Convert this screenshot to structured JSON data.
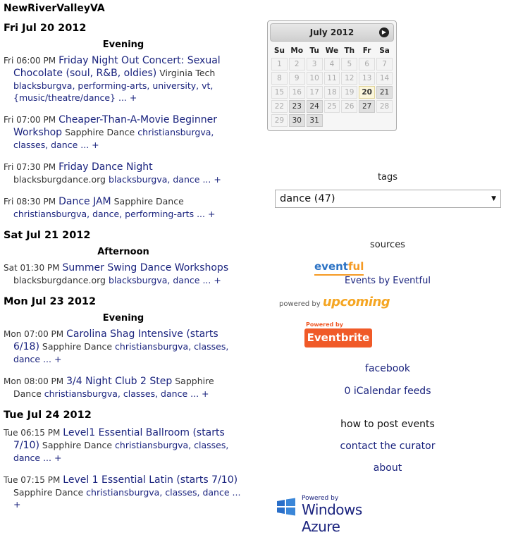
{
  "site": {
    "title": "NewRiverValleyVA"
  },
  "days": [
    {
      "header": "Fri Jul 20 2012",
      "period": "Evening",
      "events": [
        {
          "time": "Fri 06:00 PM",
          "title": "Friday Night Out Concert: Sexual Chocolate (soul, R&B, oldies)",
          "venue": "Virginia Tech",
          "tags": "blacksburgva, performing-arts, university, vt, {music/theatre/dance}",
          "more": "... +"
        },
        {
          "time": "Fri 07:00 PM",
          "title": "Cheaper-Than-A-Movie Beginner Workshop",
          "venue": "Sapphire Dance",
          "tags": "christiansburgva, classes, dance",
          "more": "... +"
        },
        {
          "time": "Fri 07:30 PM",
          "title": "Friday Dance Night",
          "venue": "blacksburgdance.org",
          "tags": "blacksburgva, dance",
          "more": "... +"
        },
        {
          "time": "Fri 08:30 PM",
          "title": "Dance JAM",
          "venue": "Sapphire Dance",
          "tags": "christiansburgva, dance, performing-arts",
          "more": "... +"
        }
      ]
    },
    {
      "header": "Sat Jul 21 2012",
      "period": "Afternoon",
      "events": [
        {
          "time": "Sat 01:30 PM",
          "title": "Summer Swing Dance Workshops",
          "venue": "blacksburgdance.org",
          "tags": "blacksburgva, dance",
          "more": "... +"
        }
      ]
    },
    {
      "header": "Mon Jul 23 2012",
      "period": "Evening",
      "events": [
        {
          "time": "Mon 07:00 PM",
          "title": "Carolina Shag Intensive (starts 6/18)",
          "venue": "Sapphire Dance",
          "tags": "christiansburgva, classes, dance",
          "more": "... +"
        },
        {
          "time": "Mon 08:00 PM",
          "title": "3/4 Night Club 2 Step",
          "venue": "Sapphire Dance",
          "tags": "christiansburgva, classes, dance",
          "more": "... +"
        }
      ]
    },
    {
      "header": "Tue Jul 24 2012",
      "period": "",
      "events": [
        {
          "time": "Tue 06:15 PM",
          "title": "Level1 Essential Ballroom (starts 7/10)",
          "venue": "Sapphire Dance",
          "tags": "christiansburgva, classes, dance",
          "more": "... +"
        },
        {
          "time": "Tue 07:15 PM",
          "title": "Level 1 Essential Latin (starts 7/10)",
          "venue": "Sapphire Dance",
          "tags": "christiansburgva, classes, dance",
          "more": "... +"
        }
      ]
    }
  ],
  "calendar": {
    "month_label": "July 2012",
    "next_icon": "next-arrow-icon",
    "weekdays": [
      "Su",
      "Mo",
      "Tu",
      "We",
      "Th",
      "Fr",
      "Sa"
    ],
    "weeks": [
      [
        "1",
        "2",
        "3",
        "4",
        "5",
        "6",
        "7"
      ],
      [
        "8",
        "9",
        "10",
        "11",
        "12",
        "13",
        "14"
      ],
      [
        "15",
        "16",
        "17",
        "18",
        "19",
        "20",
        "21"
      ],
      [
        "22",
        "23",
        "24",
        "25",
        "26",
        "27",
        "28"
      ],
      [
        "29",
        "30",
        "31",
        "",
        "",
        "",
        ""
      ]
    ],
    "highlighted": [
      "20",
      "21",
      "23",
      "24",
      "27",
      "30",
      "31"
    ],
    "today": "20"
  },
  "sidebar": {
    "tags_label": "tags",
    "tags_selected": "dance (47)",
    "sources_label": "sources",
    "eventful_logo_a": "event",
    "eventful_logo_b": "ful",
    "eventful_link": "Events by Eventful",
    "upcoming_small": "powered by",
    "upcoming_big": "upcoming",
    "eventbrite_small": "Powered by",
    "eventbrite_big": "Eventbrite",
    "facebook": "facebook",
    "ical": "0 iCalendar feeds",
    "howto": "how to post events",
    "contact": "contact the curator",
    "about": "about",
    "azure_small": "Powered by",
    "azure_big": "Windows Azure"
  }
}
